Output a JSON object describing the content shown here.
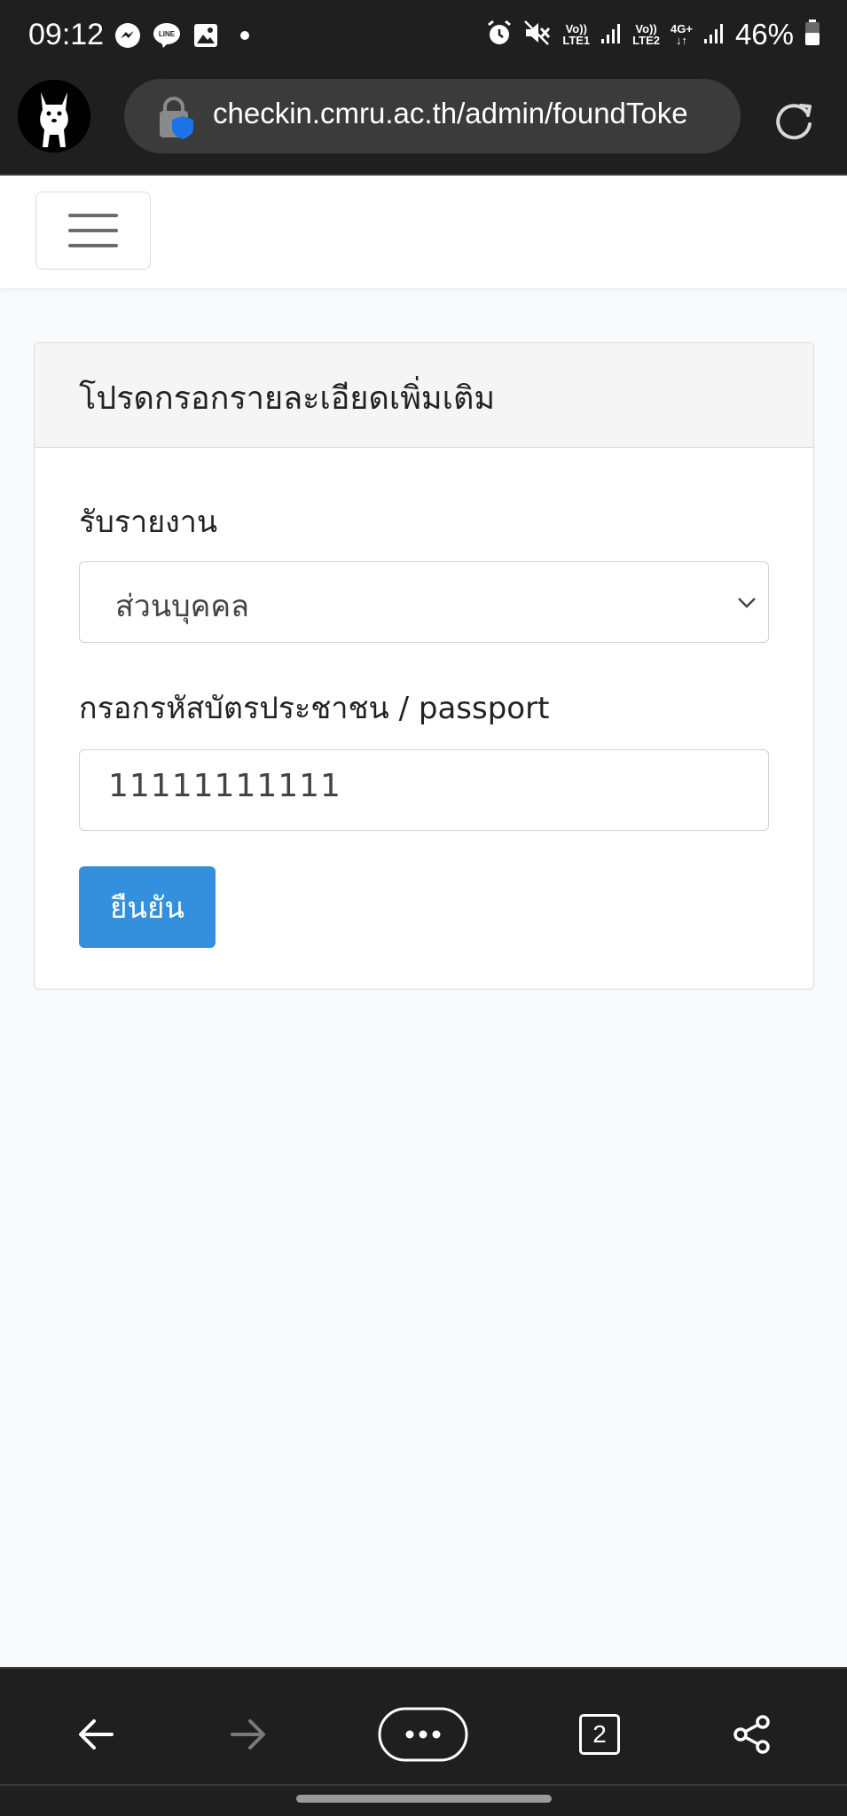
{
  "status_bar": {
    "time": "09:12",
    "battery_percent": "46%",
    "network": {
      "sim1_top": "Vo))",
      "sim1_bottom": "LTE1",
      "sim2_top": "Vo))",
      "sim2_bottom": "LTE2",
      "data_label": "4G+"
    },
    "left_icons": [
      "messenger-icon",
      "line-icon",
      "gallery-icon",
      "dot-icon"
    ],
    "right_icons": [
      "alarm-icon",
      "mute-icon",
      "signal-icon",
      "battery-icon"
    ]
  },
  "browser": {
    "url": "checkin.cmru.ac.th/admin/foundToke",
    "tab_count": "2"
  },
  "card": {
    "header": "โปรดกรอกรายละเอียดเพิ่มเติม",
    "field1_label": "รับรายงาน",
    "field1_selected": "ส่วนบุคคล",
    "field2_label": "กรอกรหัสบัตรประชาชน / passport",
    "field2_value": "11111111111",
    "submit_label": "ยืนยัน"
  },
  "colors": {
    "primary_button": "#3490dc",
    "chrome_bg": "#1f1f1f",
    "page_bg": "#f8f9fb"
  }
}
